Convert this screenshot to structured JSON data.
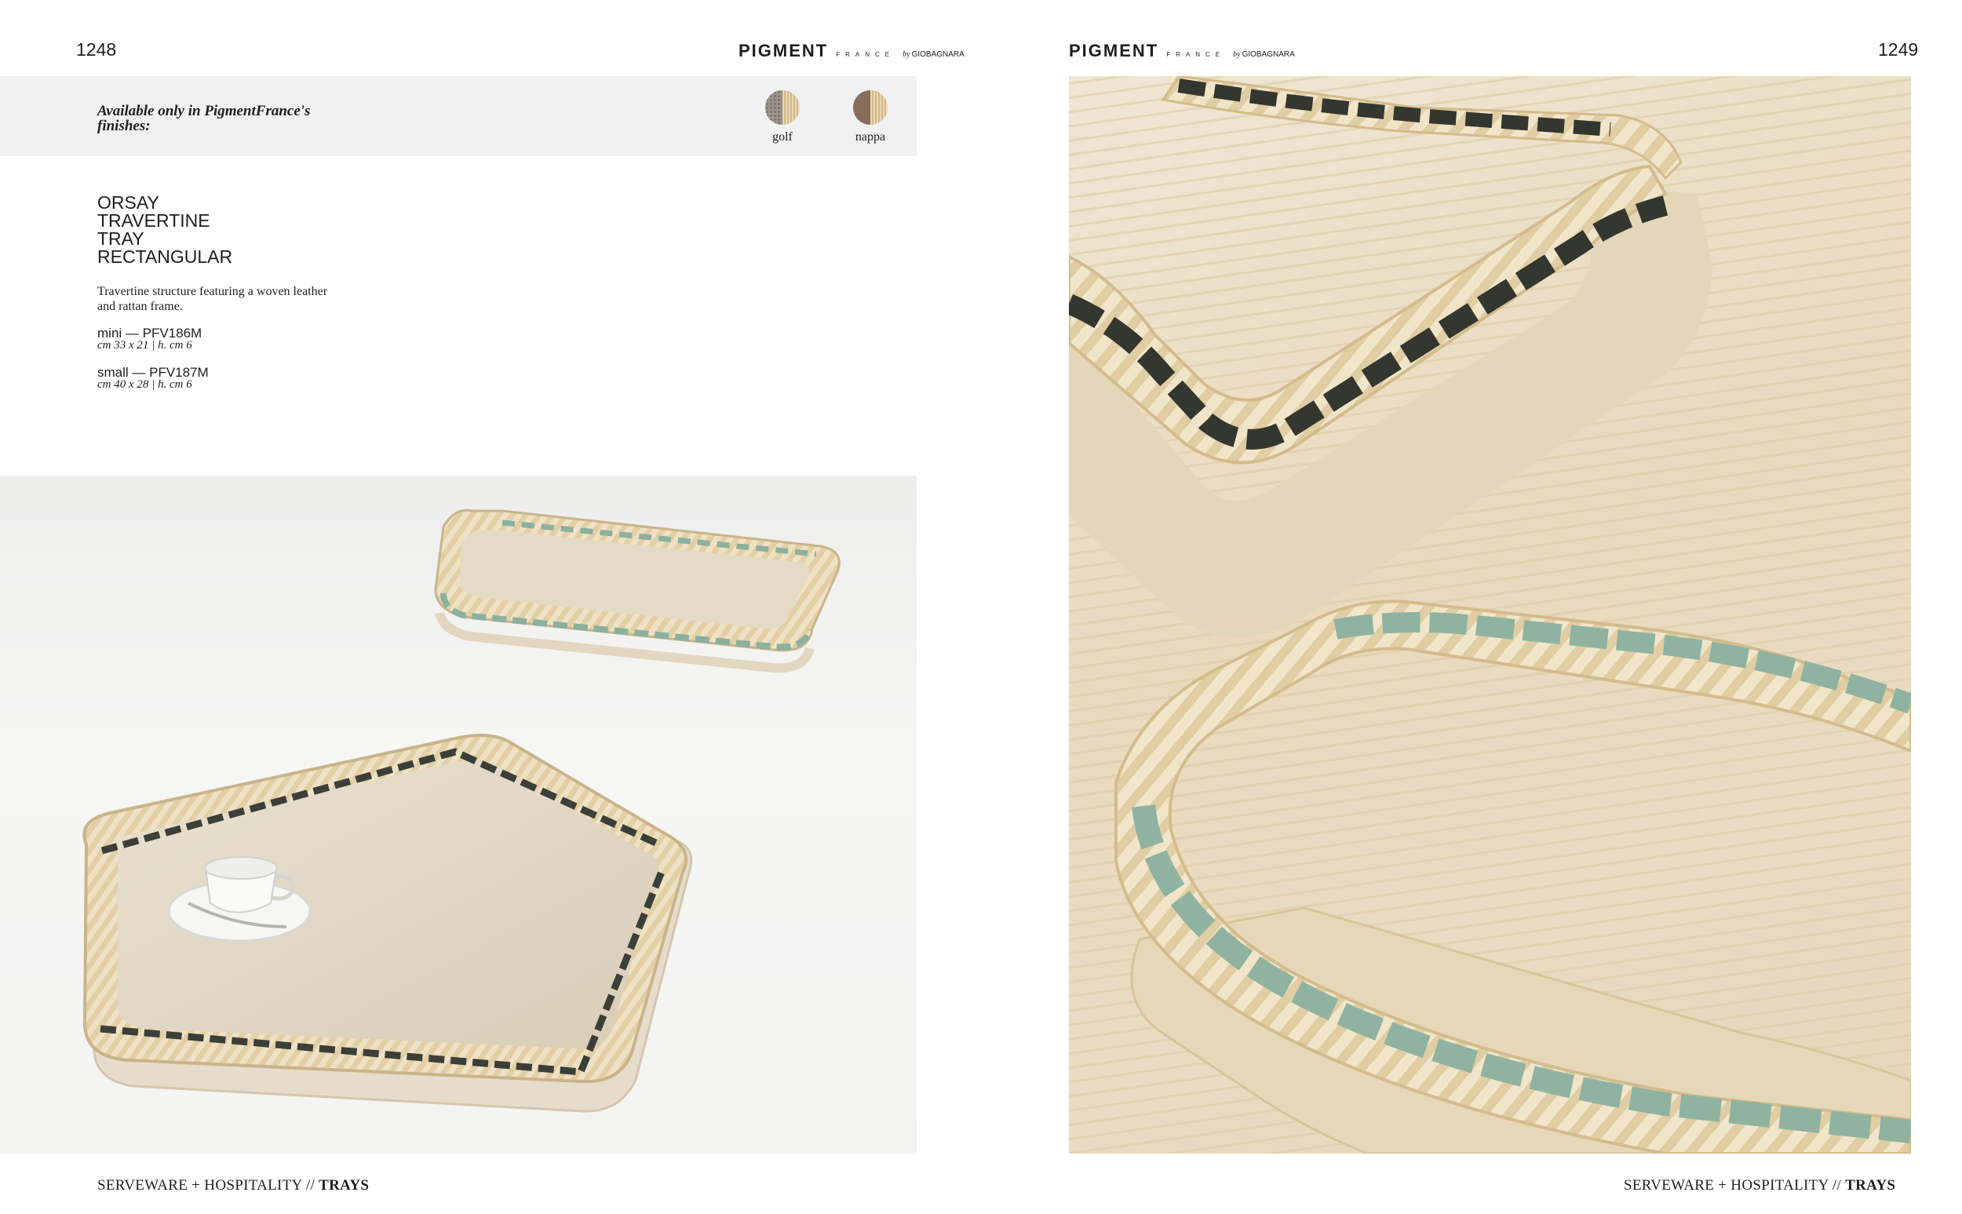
{
  "left_page": {
    "page_number": "1248",
    "brand": {
      "name": "PIGMENT",
      "sub": "FRANCE",
      "by": "by",
      "maker": "GIOBAGNARA"
    },
    "finishes": {
      "heading": "Available only in PigmentFrance's finishes:",
      "items": [
        {
          "label": "golf",
          "color": "#9c948a"
        },
        {
          "label": "nappa",
          "color": "#8a6c5a"
        }
      ]
    },
    "product": {
      "title_lines": [
        "ORSAY",
        "TRAVERTINE",
        "TRAY",
        "RECTANGULAR"
      ],
      "description": "Travertine structure featuring a woven leather and rattan frame.",
      "variants": [
        {
          "code": "mini — PFV186M",
          "dimensions": "cm 33 x 21 | h. cm 6"
        },
        {
          "code": "small — PFV187M",
          "dimensions": "cm 40 x 28 | h. cm 6"
        }
      ]
    },
    "footer": {
      "section": "SERVEWARE + HOSPITALITY // ",
      "category": "TRAYS"
    }
  },
  "right_page": {
    "page_number": "1249",
    "brand": {
      "name": "PIGMENT",
      "sub": "FRANCE",
      "by": "by",
      "maker": "GIOBAGNARA"
    },
    "footer": {
      "section": "SERVEWARE + HOSPITALITY // ",
      "category": "TRAYS"
    }
  }
}
